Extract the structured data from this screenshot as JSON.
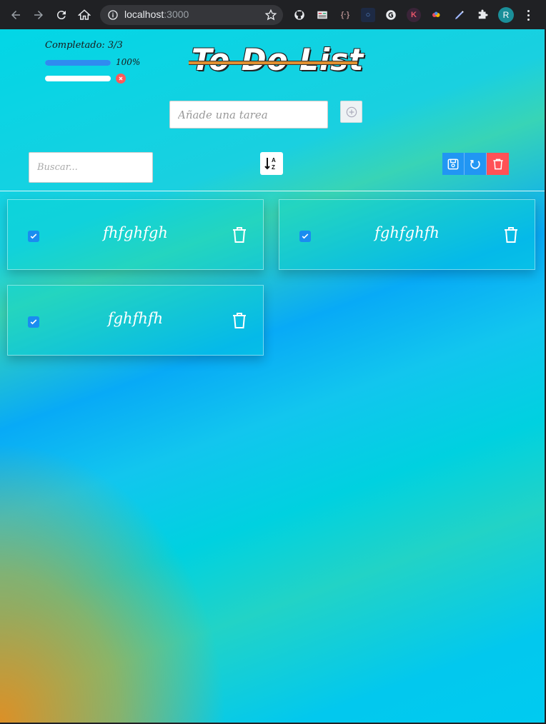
{
  "browser": {
    "url_host": "localhost",
    "url_port": ":3000",
    "profile_initial": "R",
    "extensions": [
      "github-icon",
      "mail-icon",
      "json-icon",
      "dark-ext-icon",
      "grammar-icon",
      "k-ext-icon",
      "color-ext-icon",
      "pen-ext-icon",
      "puzzle-icon"
    ]
  },
  "app": {
    "title": "To Do List",
    "progress": {
      "label": "Completado: 3/3",
      "percent_label": "100%",
      "completed_fraction": 1.0
    },
    "add": {
      "placeholder": "Añade una tarea",
      "value": ""
    },
    "search": {
      "placeholder": "Buscar...",
      "value": ""
    },
    "tasks": [
      {
        "text": "fhfghfgh",
        "done": true
      },
      {
        "text": "fghfghfh",
        "done": true
      },
      {
        "text": "fghfhfh",
        "done": true
      }
    ]
  },
  "colors": {
    "accent": "#2196f3",
    "danger": "#ff5156",
    "progress_fill": "#2f8bf0"
  }
}
